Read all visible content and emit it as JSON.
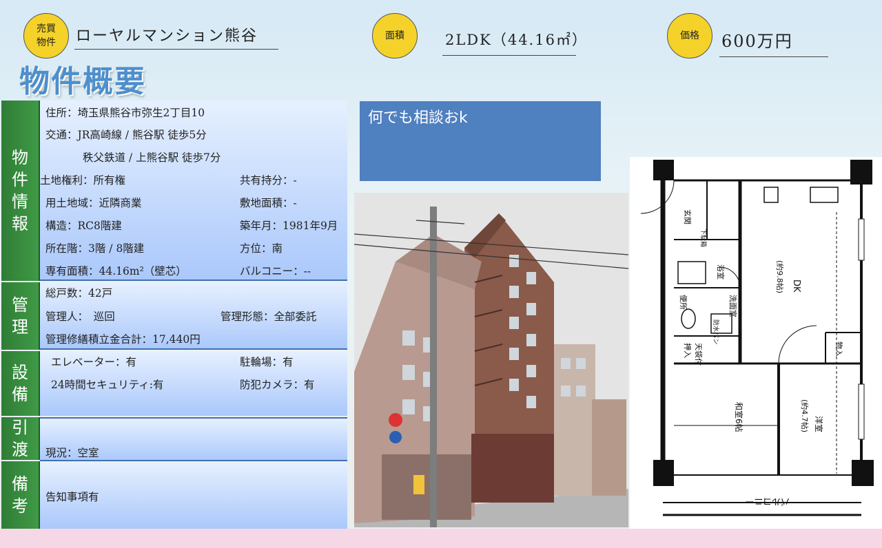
{
  "header": {
    "badge_line1": "売買",
    "badge_line2": "物件",
    "property_name": "ローヤルマンション熊谷",
    "area_label": "面積",
    "area_value": "2LDK（44.16㎡）",
    "price_label": "価格",
    "price_value": "600万円"
  },
  "page_title": "物件概要",
  "sections": {
    "property": {
      "label": [
        "物",
        "件",
        "情",
        "報"
      ],
      "address": "住所：埼玉県熊谷市弥生2丁目10",
      "access1": "交通：JR高崎線 / 熊谷駅 徒歩5分",
      "access2": "秩父鉄道 / 上熊谷駅 徒歩7分",
      "land_right": "土地権利：所有権",
      "co_ownership": "共有持分：-",
      "zoning": "用土地域：近隣商業",
      "site_area": "敷地面積：-",
      "structure": "構造：RC8階建",
      "built": "築年月：1981年9月",
      "floor": "所在階：3階 / 8階建",
      "direction": "方位：南",
      "exclusive_area": "専有面積：44.16m²（壁芯）",
      "balcony": "バルコニー：--"
    },
    "management": {
      "label": [
        "管",
        "理"
      ],
      "total_units": "総戸数：42戸",
      "manager": "管理人：　巡回",
      "management_form": "管理形態：全部委託",
      "fees": "管理修繕積立金合計：17,440円"
    },
    "facilities": {
      "label": [
        "設",
        "備"
      ],
      "elevator": "エレベーター：有",
      "bicycle": "駐輪場：有",
      "security": "24時間セキュリティ:有",
      "camera": "防犯カメラ：有"
    },
    "handover": {
      "label": [
        "引",
        "渡"
      ],
      "status": "現況：空室"
    },
    "remarks": {
      "label": [
        "備",
        "考"
      ],
      "note": "告知事項有"
    }
  },
  "banner_text": "何でも相談おk",
  "floor_plan": {
    "entrance": "玄関",
    "dk": "DK",
    "dk_size": "(約9.8帖)",
    "washroom": "洗面室",
    "toilet": "便所",
    "bath": "浴室",
    "washer": "防水パン",
    "closet": "押入",
    "ceiling_storage": "天袋付",
    "japanese_room": "和室6帖",
    "western_room": "洋室",
    "western_size": "(約4.7帖)",
    "balcony": "バルコニー",
    "storage": "物入",
    "storage2": "下駄箱"
  },
  "colors": {
    "badge": "#f4d22a",
    "section_label": "#3f9a46",
    "banner": "#4f80c0",
    "title": "#4e8fcc"
  }
}
